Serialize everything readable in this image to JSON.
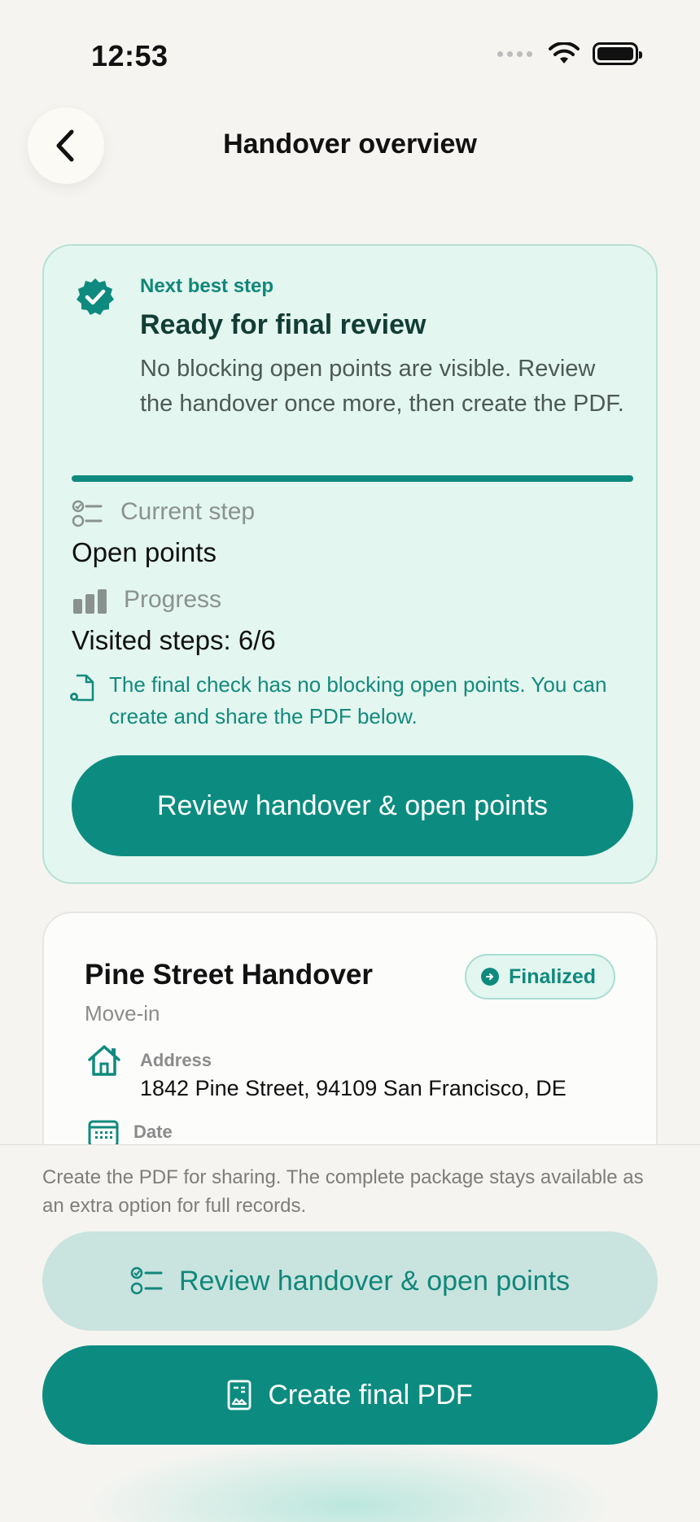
{
  "status_bar": {
    "time": "12:53"
  },
  "header": {
    "title": "Handover overview"
  },
  "step_card": {
    "eyebrow": "Next best step",
    "title": "Ready for final review",
    "description": "No blocking open points are visible. Review the handover once more, then create the PDF.",
    "progress_fraction": 1.0,
    "current_step_label": "Current step",
    "current_step_value": "Open points",
    "progress_label": "Progress",
    "progress_value": "Visited steps: 6/6",
    "info_note": "The final check has no blocking open points. You can create and share the PDF below.",
    "cta_label": "Review handover & open points"
  },
  "handover": {
    "title": "Pine Street Handover",
    "subtitle": "Move-in",
    "badge": "Finalized",
    "address_label": "Address",
    "address_value": "1842 Pine Street, 94109 San Francisco, DE",
    "date_label": "Date"
  },
  "bottom": {
    "note": "Create the PDF for sharing. The complete package stays available as an extra option for full records.",
    "review_button": "Review handover & open points",
    "pdf_button": "Create final PDF"
  },
  "colors": {
    "accent": "#0c8c80",
    "card_bg": "#e3f6ef",
    "page_bg": "#f5f4f1"
  },
  "icons": [
    "chevron-left-icon",
    "wifi-icon",
    "battery-icon",
    "verified-seal-icon",
    "checklist-icon",
    "bar-chart-icon",
    "document-gear-icon",
    "arrow-right-circle-icon",
    "home-icon",
    "calendar-icon",
    "pdf-document-icon"
  ]
}
